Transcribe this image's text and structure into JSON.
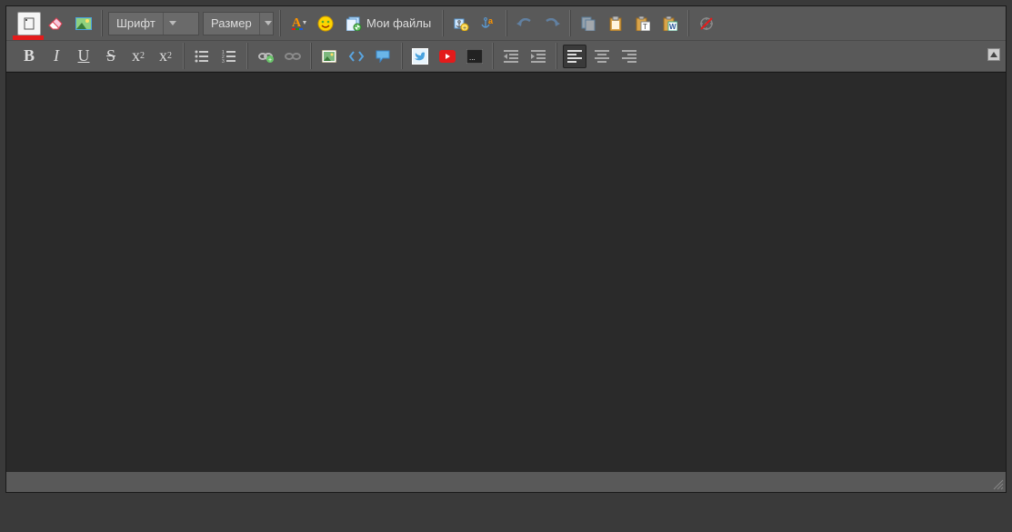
{
  "toolbar": {
    "font_label": "Шрифт",
    "size_label": "Размер",
    "my_files_label": "Мои файлы"
  },
  "format": {
    "bold": "B",
    "italic": "I",
    "underline": "U",
    "strike": "S",
    "sub_base": "x",
    "sub_sub": "2",
    "sup_base": "x",
    "sup_sup": "2"
  }
}
